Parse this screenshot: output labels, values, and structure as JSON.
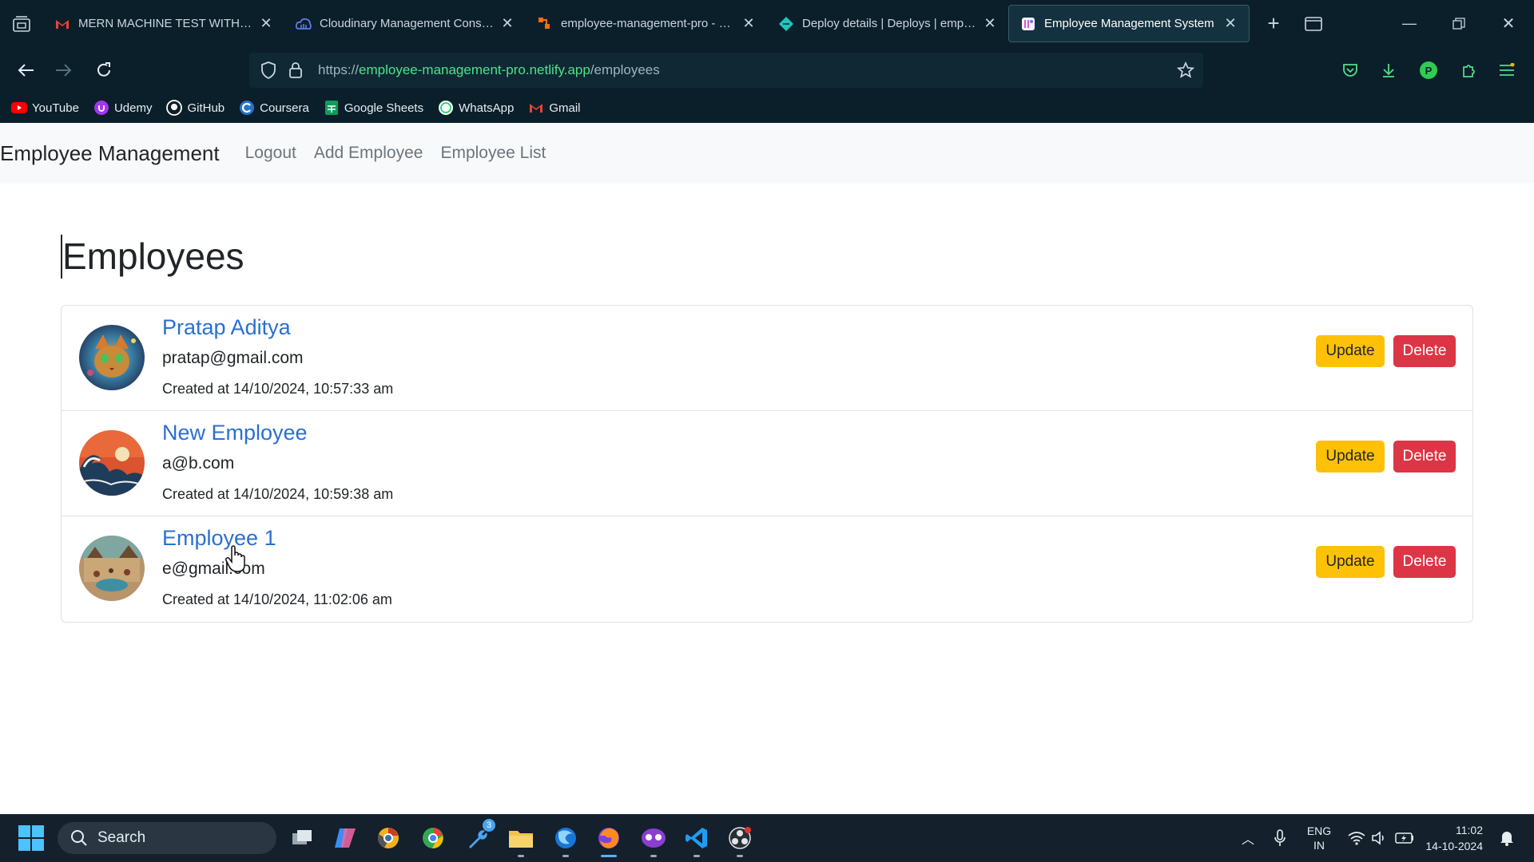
{
  "browser": {
    "tabs": [
      {
        "title": "MERN MACHINE TEST WITH REFE",
        "icon": "gmail-icon",
        "active": false
      },
      {
        "title": "Cloudinary Management Console",
        "icon": "cloudinary-icon",
        "active": false
      },
      {
        "title": "employee-management-pro - Rep",
        "icon": "render-icon",
        "active": false
      },
      {
        "title": "Deploy details | Deploys | employ",
        "icon": "netlify-icon",
        "active": false
      },
      {
        "title": "Employee Management System",
        "icon": "react-icon",
        "active": true
      }
    ],
    "url": {
      "scheme": "https://",
      "host": "employee-management-pro.netlify.app",
      "path": "/employees"
    },
    "profile_initial": "P",
    "bookmarks": [
      {
        "label": "YouTube",
        "icon": "youtube-icon",
        "color": "#ff0000"
      },
      {
        "label": "Udemy",
        "icon": "udemy-icon",
        "color": "#a435f0"
      },
      {
        "label": "GitHub",
        "icon": "github-icon",
        "color": "#ffffff"
      },
      {
        "label": "Coursera",
        "icon": "coursera-icon",
        "color": "#2a73cc"
      },
      {
        "label": "Google Sheets",
        "icon": "sheets-icon",
        "color": "#0f9d58"
      },
      {
        "label": "WhatsApp",
        "icon": "whatsapp-icon",
        "color": "#25d366"
      },
      {
        "label": "Gmail",
        "icon": "gmail-icon",
        "color": "#ea4335"
      }
    ]
  },
  "app": {
    "brand": "Employee Management",
    "nav": [
      "Logout",
      "Add Employee",
      "Employee List"
    ],
    "heading": "Employees",
    "update_label": "Update",
    "delete_label": "Delete",
    "employees": [
      {
        "name": "Pratap Aditya",
        "email": "pratap@gmail.com",
        "created": "Created at 14/10/2024, 10:57:33 am"
      },
      {
        "name": "New Employee",
        "email": "a@b.com",
        "created": "Created at 14/10/2024, 10:59:38 am"
      },
      {
        "name": "Employee 1",
        "email": "e@gmail.com",
        "created": "Created at 14/10/2024, 11:02:06 am"
      }
    ]
  },
  "taskbar": {
    "search_placeholder": "Search",
    "lang_line1": "ENG",
    "lang_line2": "IN",
    "time": "11:02",
    "date": "14-10-2024",
    "badge_count": "3"
  },
  "colors": {
    "accent_link": "#2b6fd1",
    "update_btn": "#ffc107",
    "delete_btn": "#dc3545",
    "chrome_bg": "#0b1f2b"
  }
}
